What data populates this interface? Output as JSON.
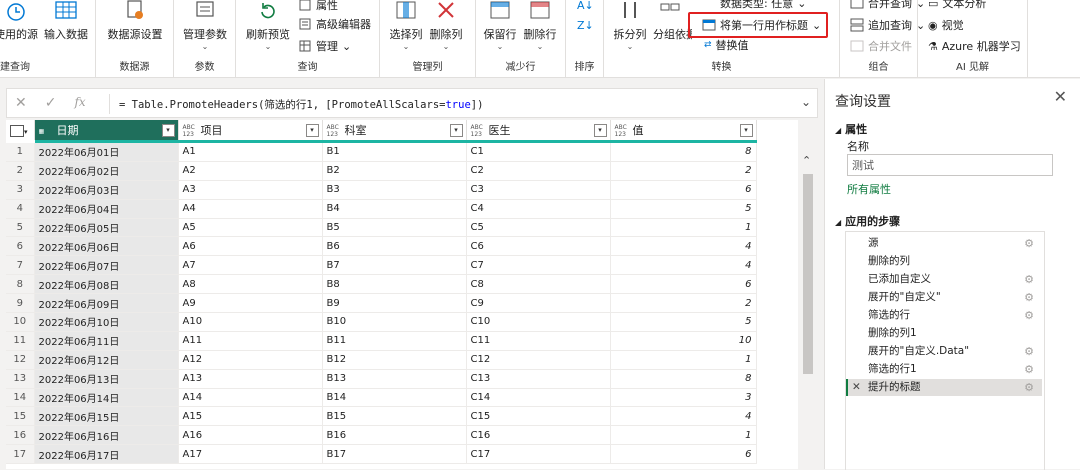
{
  "ribbon": {
    "groups": [
      {
        "label": "建查询"
      },
      {
        "label": "数据源"
      },
      {
        "label": "参数"
      },
      {
        "label": "查询"
      },
      {
        "label": "管理列"
      },
      {
        "label": "减少行"
      },
      {
        "label": "排序"
      },
      {
        "label": "转换"
      },
      {
        "label": "组合"
      },
      {
        "label": "AI 见解"
      }
    ],
    "buttons": {
      "recent_sources": "使用的源",
      "enter_data": "输入数据",
      "data_source_settings": "数据源设置",
      "manage_params": "管理参数",
      "refresh_preview": "刷新预览",
      "properties": "属性",
      "advanced_editor": "高级编辑器",
      "manage": "管理",
      "choose_columns": "选择列",
      "remove_columns": "删除列",
      "keep_rows": "保留行",
      "remove_rows": "删除行",
      "split_column": "拆分列",
      "group_by": "分组依据",
      "data_type": "数据类型: 任意",
      "use_first_row": "将第一行用作标题",
      "replace_values": "替换值",
      "merge_queries": "合并查询",
      "append_queries": "追加查询",
      "combine_files": "合并文件",
      "text_analytics": "文本分析",
      "vision": "视觉",
      "azure_ml": "Azure 机器学习"
    }
  },
  "formula": {
    "prefix": "= Table.PromoteHeaders(筛选的行1, [PromoteAllScalars=",
    "keyword": "true",
    "suffix": "])"
  },
  "grid": {
    "columns": [
      {
        "name": "日期",
        "type": "calendar"
      },
      {
        "name": "项目",
        "type": "ABC 123"
      },
      {
        "name": "科室",
        "type": "ABC 123"
      },
      {
        "name": "医生",
        "type": "ABC 123"
      },
      {
        "name": "值",
        "type": "ABC 123"
      }
    ],
    "rows": [
      [
        "1",
        "2022年06月01日",
        "A1",
        "B1",
        "C1",
        "8"
      ],
      [
        "2",
        "2022年06月02日",
        "A2",
        "B2",
        "C2",
        "2"
      ],
      [
        "3",
        "2022年06月03日",
        "A3",
        "B3",
        "C3",
        "6"
      ],
      [
        "4",
        "2022年06月04日",
        "A4",
        "B4",
        "C4",
        "5"
      ],
      [
        "5",
        "2022年06月05日",
        "A5",
        "B5",
        "C5",
        "1"
      ],
      [
        "6",
        "2022年06月06日",
        "A6",
        "B6",
        "C6",
        "4"
      ],
      [
        "7",
        "2022年06月07日",
        "A7",
        "B7",
        "C7",
        "4"
      ],
      [
        "8",
        "2022年06月08日",
        "A8",
        "B8",
        "C8",
        "6"
      ],
      [
        "9",
        "2022年06月09日",
        "A9",
        "B9",
        "C9",
        "2"
      ],
      [
        "10",
        "2022年06月10日",
        "A10",
        "B10",
        "C10",
        "5"
      ],
      [
        "11",
        "2022年06月11日",
        "A11",
        "B11",
        "C11",
        "10"
      ],
      [
        "12",
        "2022年06月12日",
        "A12",
        "B12",
        "C12",
        "1"
      ],
      [
        "13",
        "2022年06月13日",
        "A13",
        "B13",
        "C13",
        "8"
      ],
      [
        "14",
        "2022年06月14日",
        "A14",
        "B14",
        "C14",
        "3"
      ],
      [
        "15",
        "2022年06月15日",
        "A15",
        "B15",
        "C15",
        "4"
      ],
      [
        "16",
        "2022年06月16日",
        "A16",
        "B16",
        "C16",
        "1"
      ],
      [
        "17",
        "2022年06月17日",
        "A17",
        "B17",
        "C17",
        "6"
      ]
    ]
  },
  "settings": {
    "title": "查询设置",
    "properties_header": "属性",
    "name_label": "名称",
    "name_value": "测试",
    "all_properties": "所有属性",
    "steps_header": "应用的步骤",
    "steps": [
      {
        "label": "源",
        "gear": true
      },
      {
        "label": "删除的列",
        "gear": false
      },
      {
        "label": "已添加自定义",
        "gear": true
      },
      {
        "label": "展开的\"自定义\"",
        "gear": true
      },
      {
        "label": "筛选的行",
        "gear": true
      },
      {
        "label": "删除的列1",
        "gear": false
      },
      {
        "label": "展开的\"自定义.Data\"",
        "gear": true
      },
      {
        "label": "筛选的行1",
        "gear": true
      },
      {
        "label": "提升的标题",
        "gear": true,
        "active": true
      }
    ]
  },
  "colors": {
    "accent_green": "#107c41",
    "header_teal": "#1db5a3",
    "selected_column": "#1f6f5c",
    "highlight_red": "#e02020"
  }
}
